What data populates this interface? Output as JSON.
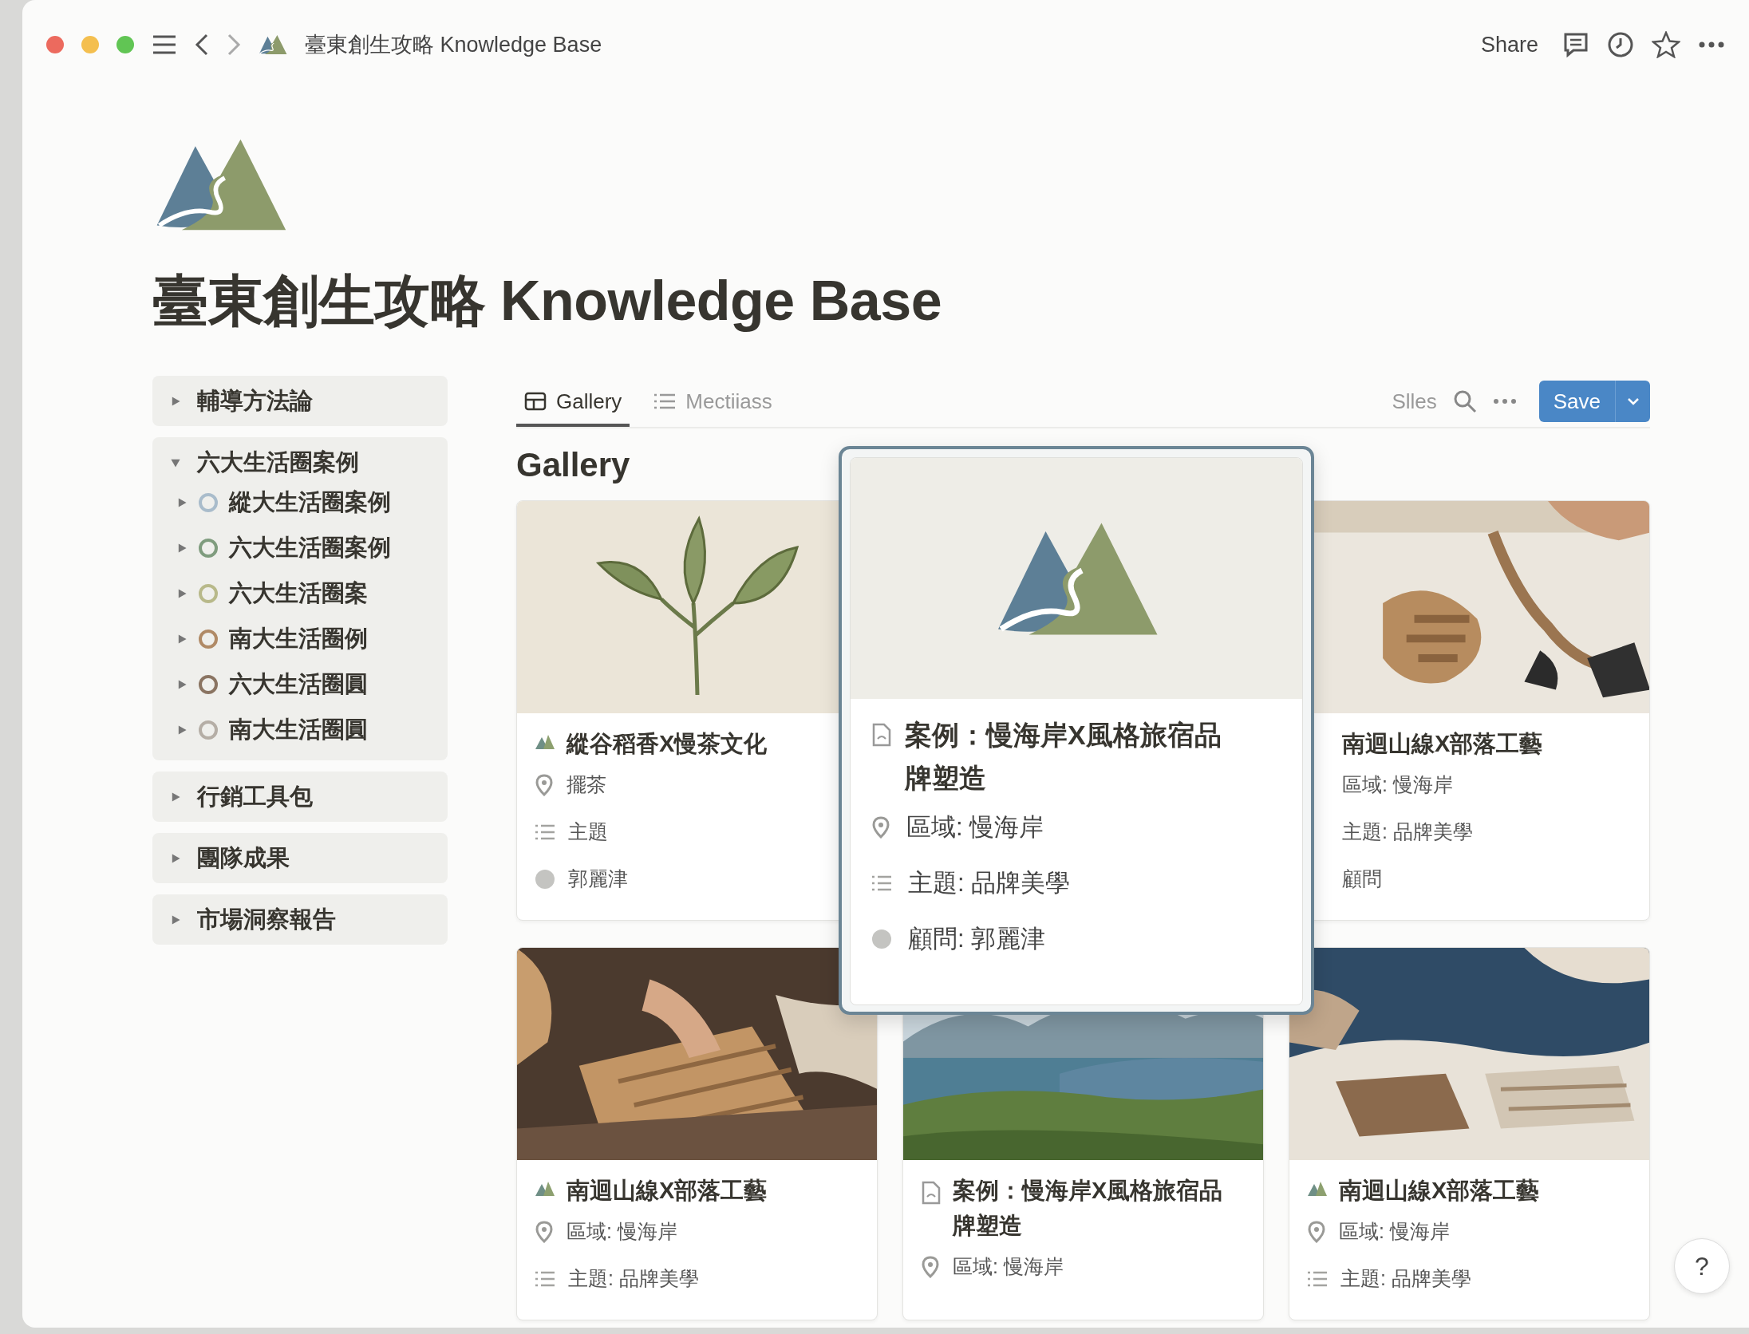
{
  "window": {
    "title": "臺東創生攻略 Knowledge Base"
  },
  "toolbar": {
    "share": "Share"
  },
  "page": {
    "title": "臺東創生攻略 Knowledge Base"
  },
  "sidebar": {
    "items": [
      {
        "label": "輔導方法論",
        "expanded": false
      },
      {
        "label": "六大生活圈案例",
        "expanded": true,
        "children": [
          {
            "label": "縱大生活圈案例",
            "expanded": false,
            "color": "#a9bccb"
          },
          {
            "label": "六大生活圈案例",
            "expanded": false,
            "color": "#7f9c7e"
          },
          {
            "label": "六大生活圈案",
            "expanded": false,
            "color": "#b8b98a"
          },
          {
            "label": "南大生活圈例",
            "expanded": false,
            "color": "#b08a66"
          },
          {
            "label": "六大生活圈圓",
            "expanded": false,
            "color": "#8a7462"
          },
          {
            "label": "南大生活圈圓",
            "expanded": false,
            "color": "#b5aea6"
          }
        ]
      },
      {
        "label": "行銷工具包",
        "expanded": false
      },
      {
        "label": "團隊成果",
        "expanded": false
      },
      {
        "label": "市場洞察報告",
        "expanded": false
      }
    ]
  },
  "view_tabs": [
    {
      "label": "Gallery",
      "selected": true
    },
    {
      "label": "Mectiiass",
      "selected": false
    }
  ],
  "view_actions": {
    "filter": "Slles",
    "save": "Save"
  },
  "gallery": {
    "heading": "Gallery",
    "cards": [
      {
        "kind": "illustrated",
        "title": "縱谷稻香X慢茶文化",
        "properties": [
          {
            "kind": "location",
            "text": "擺茶"
          },
          {
            "kind": "topic",
            "text": "主題"
          },
          {
            "kind": "person",
            "text": "郭麗津"
          }
        ]
      },
      {
        "kind": "hidden"
      },
      {
        "kind": "covered",
        "title": "南迴山線X部落工藝",
        "properties": [
          {
            "kind": "plain",
            "text": "區域: 慢海岸"
          },
          {
            "kind": "plain",
            "text": "主題: 品牌美學"
          },
          {
            "kind": "plain",
            "text": "顧問"
          }
        ]
      },
      {
        "kind": "project",
        "title": "南迴山線X部落工藝",
        "properties": [
          {
            "kind": "location",
            "text": "區域: 慢海岸"
          },
          {
            "kind": "topic",
            "text": "主題: 品牌美學"
          }
        ]
      },
      {
        "kind": "case",
        "title": "案例：慢海岸X風格旅宿品牌塑造",
        "properties": [
          {
            "kind": "location",
            "text": "區域: 慢海岸"
          }
        ]
      },
      {
        "kind": "project",
        "title": "南迴山線X部落工藝",
        "properties": [
          {
            "kind": "location",
            "text": "區域: 慢海岸"
          },
          {
            "kind": "topic",
            "text": "主題: 品牌美學"
          }
        ]
      }
    ]
  },
  "preview": {
    "title": "案例：慢海岸X風格旅宿品牌塑造",
    "properties": [
      {
        "kind": "location",
        "text": "區域: 慢海岸"
      },
      {
        "kind": "topic",
        "text": "主題: 品牌美學"
      },
      {
        "kind": "person",
        "text": "顧問: 郭麗津"
      }
    ]
  },
  "help": "?"
}
